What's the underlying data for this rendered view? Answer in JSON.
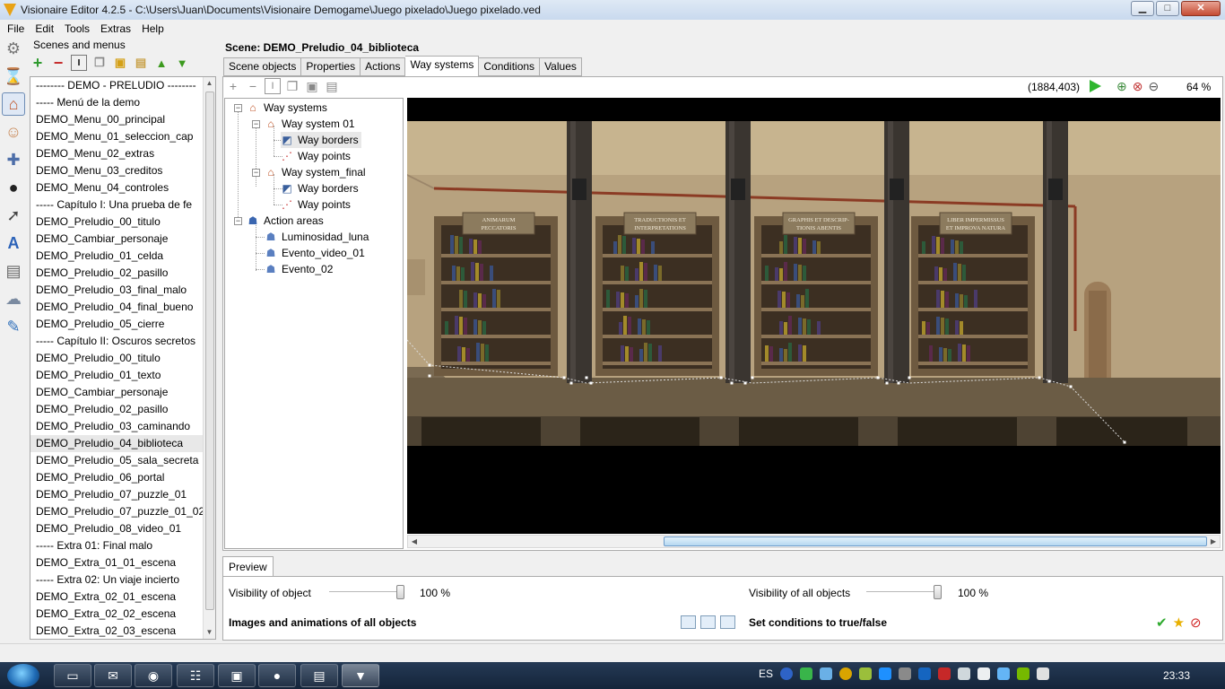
{
  "window": {
    "title": "Visionaire Editor 4.2.5 - C:\\Users\\Juan\\Documents\\Visionaire Demogame\\Juego pixelado\\Juego pixelado.ved",
    "buttons": {
      "minimize": "▁",
      "maximize": "□",
      "close": "✕"
    }
  },
  "menu": [
    "File",
    "Edit",
    "Tools",
    "Extras",
    "Help"
  ],
  "scenes_panel": {
    "label": "Scenes and menus",
    "items": [
      "-------- DEMO - PRELUDIO --------",
      "----- Menú de la demo",
      "DEMO_Menu_00_principal",
      "DEMO_Menu_01_seleccion_cap",
      "DEMO_Menu_02_extras",
      "DEMO_Menu_03_creditos",
      "DEMO_Menu_04_controles",
      "----- Capítulo I: Una prueba de fe",
      "DEMO_Preludio_00_titulo",
      "DEMO_Cambiar_personaje",
      "DEMO_Preludio_01_celda",
      "DEMO_Preludio_02_pasillo",
      "DEMO_Preludio_03_final_malo",
      "DEMO_Preludio_04_final_bueno",
      "DEMO_Preludio_05_cierre",
      "----- Capítulo II: Oscuros secretos",
      "DEMO_Preludio_00_titulo",
      "DEMO_Preludio_01_texto",
      "DEMO_Cambiar_personaje",
      "DEMO_Preludio_02_pasillo",
      "DEMO_Preludio_03_caminando",
      "DEMO_Preludio_04_biblioteca",
      "DEMO_Preludio_05_sala_secreta",
      "DEMO_Preludio_06_portal",
      "DEMO_Preludio_07_puzzle_01",
      "DEMO_Preludio_07_puzzle_01_02",
      "DEMO_Preludio_08_video_01",
      "----- Extra 01: Final malo",
      "DEMO_Extra_01_01_escena",
      "----- Extra 02: Un viaje incierto",
      "DEMO_Extra_02_01_escena",
      "DEMO_Extra_02_02_escena",
      "DEMO_Extra_02_03_escena"
    ],
    "selected_index": 21
  },
  "scene": {
    "title": "Scene: DEMO_Preludio_04_biblioteca",
    "tabs": [
      "Scene objects",
      "Properties",
      "Actions",
      "Way systems",
      "Conditions",
      "Values"
    ],
    "active_tab": 3
  },
  "way_tree": {
    "root": "Way systems",
    "ws1": "Way system 01",
    "ws1_borders": "Way borders",
    "ws1_points": "Way points",
    "ws2": "Way system_final",
    "ws2_borders": "Way borders",
    "ws2_points": "Way points",
    "areas": "Action areas",
    "area1": "Luminosidad_luna",
    "area2": "Evento_video_01",
    "area3": "Evento_02"
  },
  "canvas": {
    "coords": "(1884,403)",
    "zoom": "64 %",
    "signs": [
      {
        "line1": "ANIMARUM",
        "line2": "PECCATORIS"
      },
      {
        "line1": "TRADUCTIONIS ET",
        "line2": "INTERPRETATIONS"
      },
      {
        "line1": "GRAPHIS ET DESCRIP-",
        "line2": "TIONIS ABENTIS"
      },
      {
        "line1": "LIBER IMPERMISSUS",
        "line2": "ET IMPROVA NATURA"
      }
    ]
  },
  "preview": {
    "tab": "Preview",
    "visibility_object_label": "Visibility of object",
    "visibility_object_value": "100 %",
    "visibility_object_level": 1.0,
    "visibility_all_label": "Visibility of all objects",
    "visibility_all_value": "100 %",
    "visibility_all_level": 1.0,
    "images_label": "Images and animations of all objects",
    "conditions_label": "Set conditions to true/false"
  },
  "taskbar": {
    "lang": "ES",
    "clock": "23:33"
  },
  "colors": {
    "accent": "#2fb62f",
    "canvas_bg": "#000000",
    "wall": "#b7a27f"
  }
}
